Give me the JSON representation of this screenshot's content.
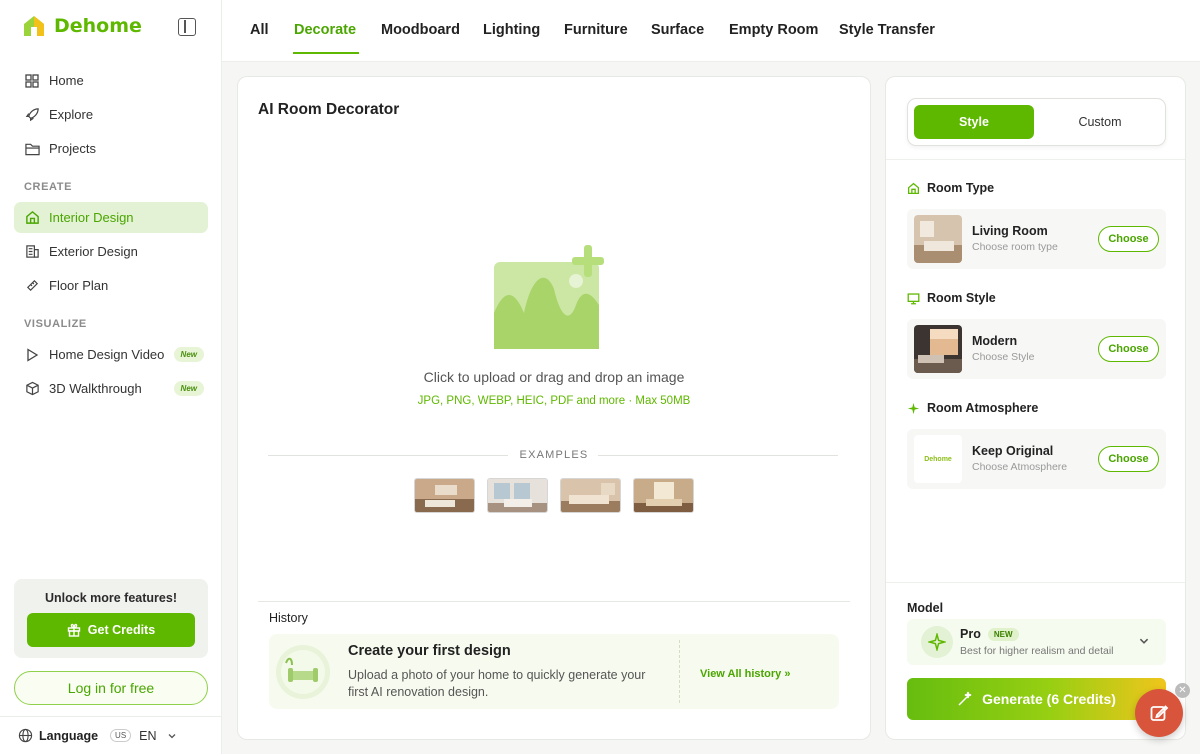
{
  "app": {
    "name": "Dehome"
  },
  "sidebar": {
    "nav": [
      {
        "label": "Home",
        "icon": "grid-icon"
      },
      {
        "label": "Explore",
        "icon": "rocket-icon"
      },
      {
        "label": "Projects",
        "icon": "folder-icon"
      }
    ],
    "create_label": "CREATE",
    "create": [
      {
        "label": "Interior Design",
        "icon": "house-icon",
        "active": true
      },
      {
        "label": "Exterior Design",
        "icon": "building-icon"
      },
      {
        "label": "Floor Plan",
        "icon": "ruler-icon"
      }
    ],
    "visualize_label": "VISUALIZE",
    "visualize": [
      {
        "label": "Home Design Video",
        "icon": "play-icon",
        "badge": "New"
      },
      {
        "label": "3D Walkthrough",
        "icon": "cube-icon",
        "badge": "New"
      }
    ],
    "unlock": {
      "title": "Unlock more features!",
      "button": "Get Credits"
    },
    "login": "Log in for free",
    "language": {
      "label": "Language",
      "flag": "US",
      "code": "EN"
    }
  },
  "tabs": [
    "All",
    "Decorate",
    "Moodboard",
    "Lighting",
    "Furniture",
    "Surface",
    "Empty Room",
    "Style Transfer"
  ],
  "active_tab": "Decorate",
  "main": {
    "title": "AI Room Decorator",
    "upload_text": "Click to upload or drag and drop an image",
    "upload_formats": "JPG, PNG, WEBP, HEIC, PDF and more · Max 50MB",
    "examples_label": "EXAMPLES",
    "history_label": "History",
    "history_title": "Create your first design",
    "history_desc": "Upload a photo of your home to quickly generate your first AI renovation design.",
    "history_link": "View All history  »"
  },
  "panel": {
    "toggle_on": "Style",
    "toggle_off": "Custom",
    "room_type": {
      "heading": "Room Type",
      "title": "Living Room",
      "sub": "Choose room type",
      "button": "Choose"
    },
    "room_style": {
      "heading": "Room Style",
      "title": "Modern",
      "sub": "Choose Style",
      "button": "Choose"
    },
    "room_atmosphere": {
      "heading": "Room Atmosphere",
      "title": "Keep Original",
      "sub": "Choose Atmosphere",
      "button": "Choose",
      "thumb_text": "Dehome"
    },
    "model_label": "Model",
    "model_name": "Pro",
    "model_badge": "NEW",
    "model_desc": "Best for higher realism and detail",
    "generate": "Generate (6 Credits)"
  },
  "colors": {
    "accent": "#5fb800",
    "accent_light": "#e3f1d4",
    "fab": "#d8553b"
  }
}
